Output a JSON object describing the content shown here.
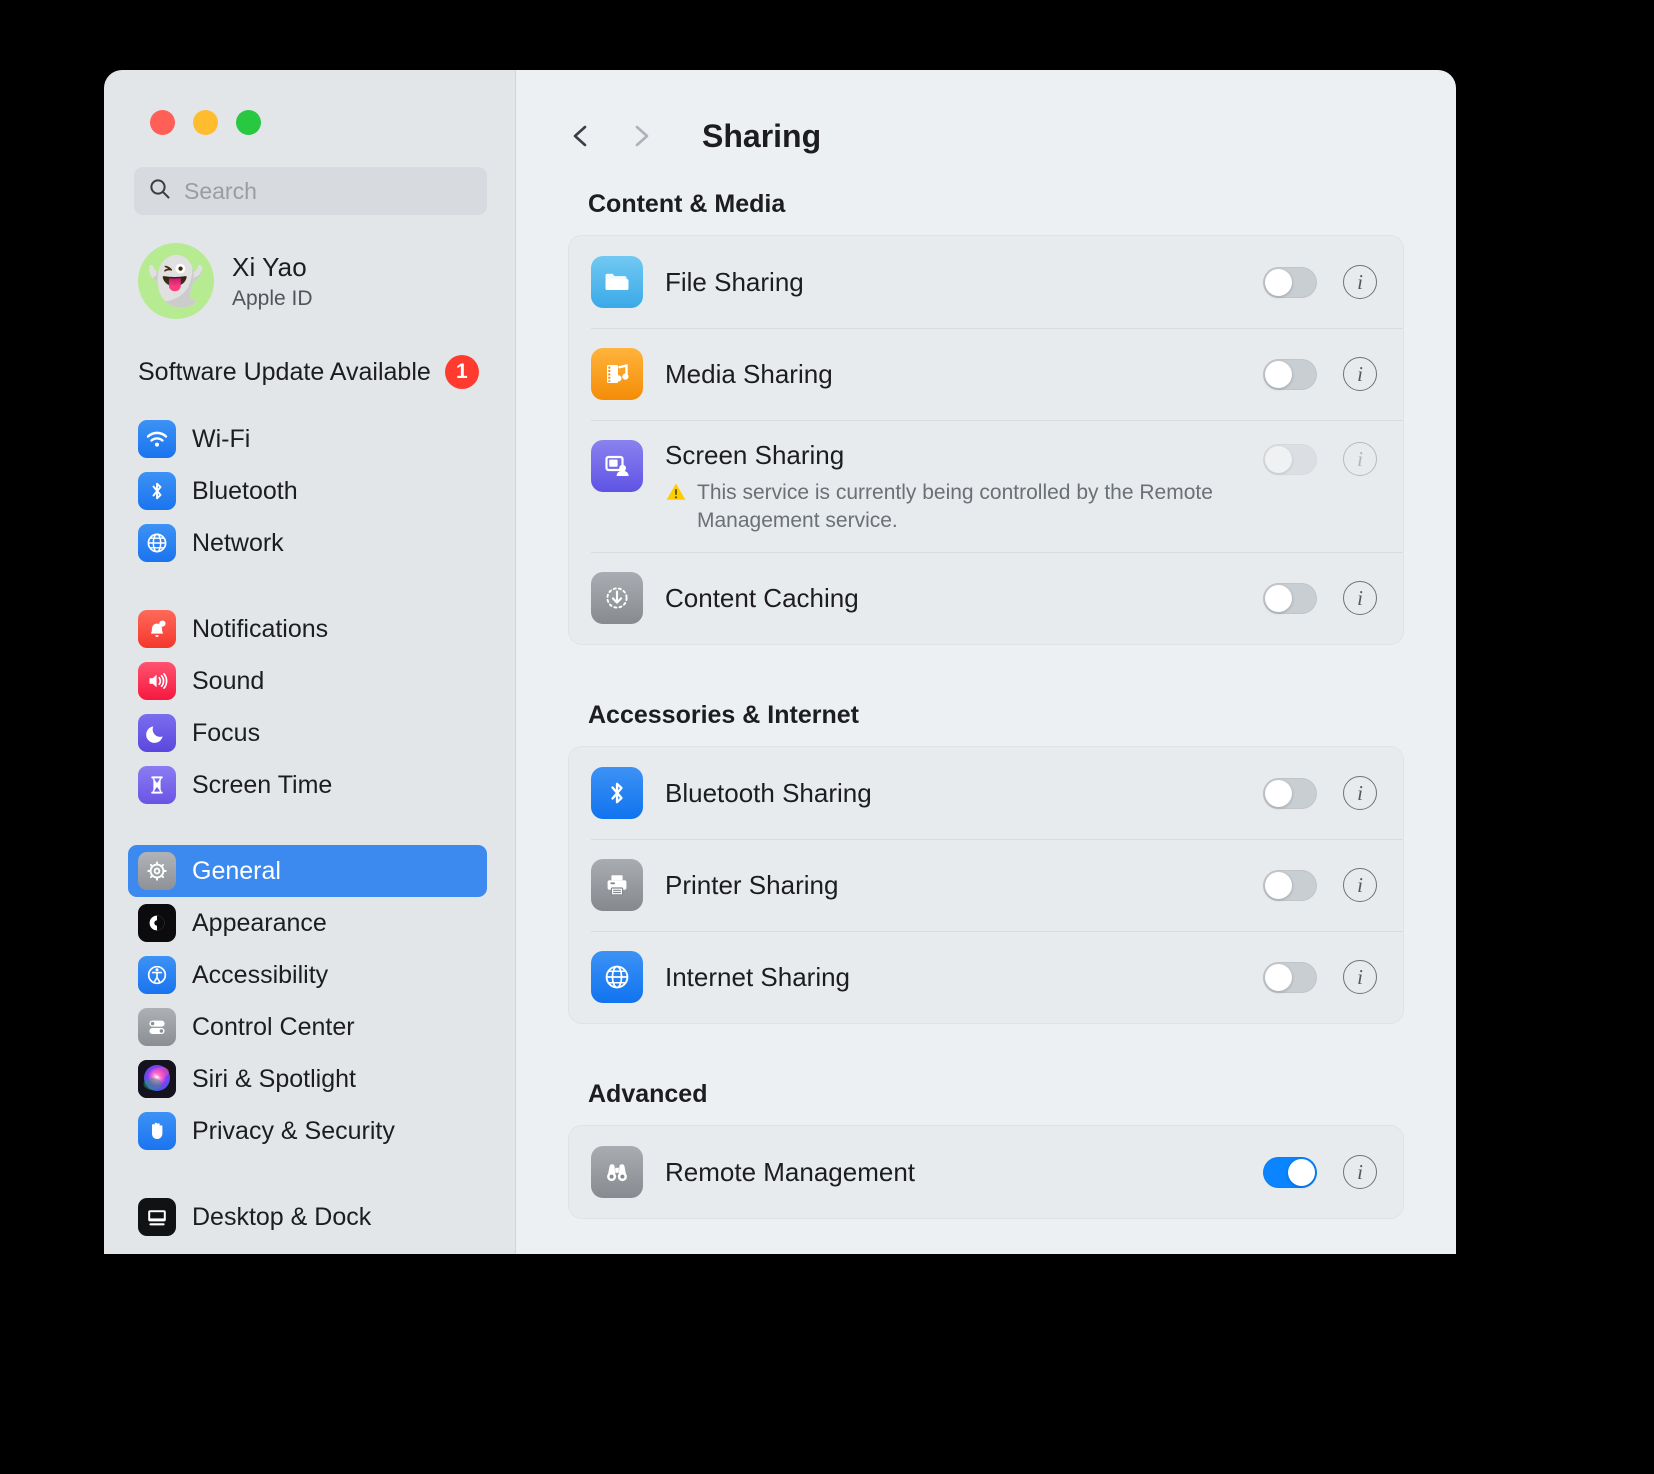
{
  "window": {
    "traffic_lights": [
      "close",
      "minimize",
      "zoom"
    ]
  },
  "sidebar": {
    "search": {
      "placeholder": "Search",
      "value": ""
    },
    "account": {
      "name": "Xi Yao",
      "subtitle": "Apple ID",
      "avatar_glyph": "👻"
    },
    "update": {
      "label": "Software Update Available",
      "badge": "1"
    },
    "groups": [
      {
        "items": [
          {
            "label": "Wi-Fi",
            "icon": "wifi-icon",
            "selected": false
          },
          {
            "label": "Bluetooth",
            "icon": "bluetooth-icon",
            "selected": false
          },
          {
            "label": "Network",
            "icon": "network-globe-icon",
            "selected": false
          }
        ]
      },
      {
        "items": [
          {
            "label": "Notifications",
            "icon": "notifications-bell-icon",
            "selected": false
          },
          {
            "label": "Sound",
            "icon": "sound-speaker-icon",
            "selected": false
          },
          {
            "label": "Focus",
            "icon": "focus-moon-icon",
            "selected": false
          },
          {
            "label": "Screen Time",
            "icon": "screen-time-hourglass-icon",
            "selected": false
          }
        ]
      },
      {
        "items": [
          {
            "label": "General",
            "icon": "general-gear-icon",
            "selected": true
          },
          {
            "label": "Appearance",
            "icon": "appearance-contrast-icon",
            "selected": false
          },
          {
            "label": "Accessibility",
            "icon": "accessibility-icon",
            "selected": false
          },
          {
            "label": "Control Center",
            "icon": "control-center-icon",
            "selected": false
          },
          {
            "label": "Siri & Spotlight",
            "icon": "siri-icon",
            "selected": false
          },
          {
            "label": "Privacy & Security",
            "icon": "privacy-hand-icon",
            "selected": false
          }
        ]
      },
      {
        "items": [
          {
            "label": "Desktop & Dock",
            "icon": "desktop-dock-icon",
            "selected": false
          }
        ]
      }
    ]
  },
  "main": {
    "nav": {
      "back": "back-chevron",
      "forward": "forward-chevron"
    },
    "title": "Sharing",
    "sections": [
      {
        "title": "Content & Media",
        "rows": [
          {
            "label": "File Sharing",
            "icon": "file-sharing-folder-icon",
            "toggle": "off",
            "disabled": false,
            "note": null
          },
          {
            "label": "Media Sharing",
            "icon": "media-sharing-icon",
            "toggle": "off",
            "disabled": false,
            "note": null
          },
          {
            "label": "Screen Sharing",
            "icon": "screen-sharing-icon",
            "toggle": "off",
            "disabled": true,
            "note": "This service is currently being controlled by the Remote Management service."
          },
          {
            "label": "Content Caching",
            "icon": "content-caching-icon",
            "toggle": "off",
            "disabled": false,
            "note": null
          }
        ]
      },
      {
        "title": "Accessories & Internet",
        "rows": [
          {
            "label": "Bluetooth Sharing",
            "icon": "bluetooth-sharing-icon",
            "toggle": "off",
            "disabled": false,
            "note": null
          },
          {
            "label": "Printer Sharing",
            "icon": "printer-sharing-icon",
            "toggle": "off",
            "disabled": false,
            "note": null
          },
          {
            "label": "Internet Sharing",
            "icon": "internet-sharing-globe-icon",
            "toggle": "off",
            "disabled": false,
            "note": null
          }
        ]
      },
      {
        "title": "Advanced",
        "rows": [
          {
            "label": "Remote Management",
            "icon": "remote-management-binoculars-icon",
            "toggle": "on",
            "disabled": false,
            "note": null
          }
        ]
      }
    ]
  },
  "colors": {
    "accent_blue": "#0a84ff",
    "selection_blue": "#3c8aef",
    "badge_red": "#ff3b30",
    "warning_yellow": "#ffcc00",
    "sidebar_bg": "#e3e6e9",
    "main_bg": "#edf0f2",
    "card_bg": "#e8ebee"
  }
}
